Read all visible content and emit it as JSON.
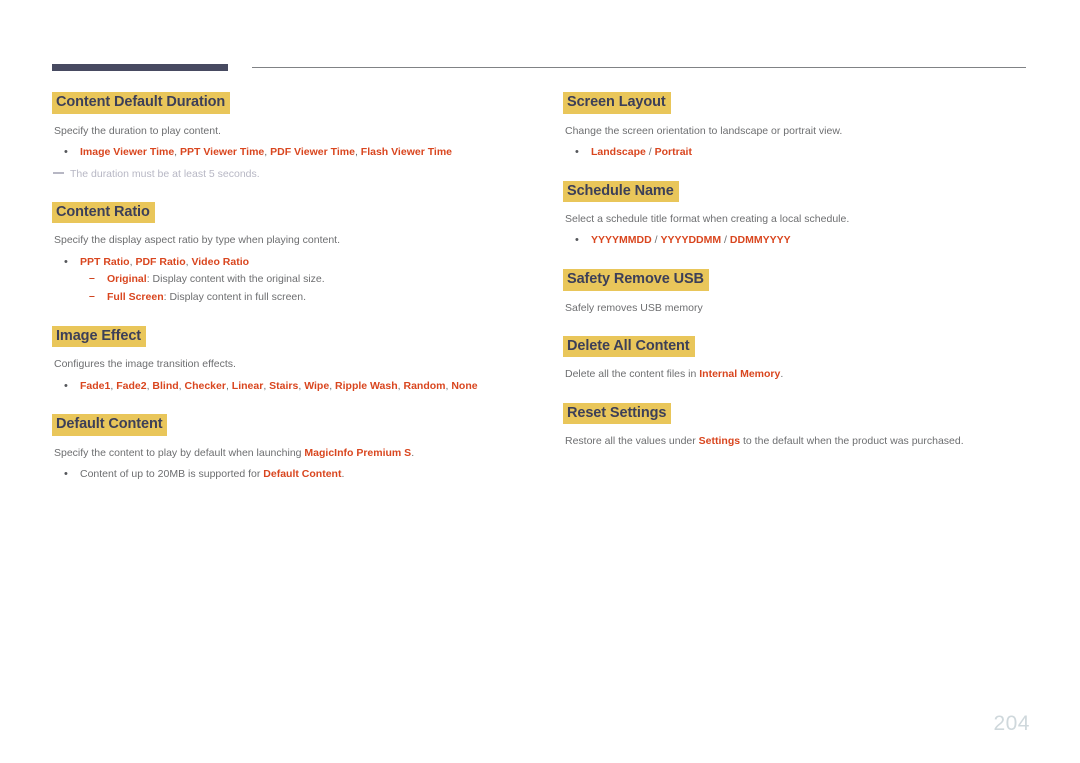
{
  "document": {
    "page_number": "204",
    "colors": {
      "heading_highlight": "#e9c65a",
      "heading_text": "#3c3f58",
      "body_text": "#6d6e70",
      "accent": "#d9461f",
      "rule_thick": "#474a61",
      "rule_thin": "#808285",
      "note_text": "#b7b7c4",
      "page_number": "#cfd8dc"
    }
  },
  "left_column": {
    "sections": [
      {
        "heading": "Content Default Duration",
        "description": "Specify the duration to play content.",
        "bullets": [
          {
            "parts": [
              {
                "text": "Image Viewer Time",
                "style": "hl"
              },
              {
                "text": ", ",
                "style": "plain"
              },
              {
                "text": "PPT Viewer Time",
                "style": "hl"
              },
              {
                "text": ", ",
                "style": "plain"
              },
              {
                "text": "PDF Viewer Time",
                "style": "hl"
              },
              {
                "text": ", ",
                "style": "plain"
              },
              {
                "text": "Flash Viewer Time",
                "style": "hl"
              }
            ]
          }
        ],
        "note": "The duration must be at least 5 seconds."
      },
      {
        "heading": "Content Ratio",
        "description": "Specify the display aspect ratio by type when playing content.",
        "bullets": [
          {
            "parts": [
              {
                "text": "PPT Ratio",
                "style": "hl"
              },
              {
                "text": ", ",
                "style": "plain"
              },
              {
                "text": "PDF Ratio",
                "style": "hl"
              },
              {
                "text": ", ",
                "style": "plain"
              },
              {
                "text": "Video Ratio",
                "style": "hl"
              }
            ],
            "subbullets": [
              {
                "parts": [
                  {
                    "text": "Original",
                    "style": "hl"
                  },
                  {
                    "text": ": Display content with the original size.",
                    "style": "plain"
                  }
                ]
              },
              {
                "parts": [
                  {
                    "text": "Full Screen",
                    "style": "hl"
                  },
                  {
                    "text": ": Display content in full screen.",
                    "style": "plain"
                  }
                ]
              }
            ]
          }
        ]
      },
      {
        "heading": "Image Effect",
        "description": "Configures the image transition effects.",
        "bullets": [
          {
            "parts": [
              {
                "text": "Fade1",
                "style": "hl"
              },
              {
                "text": ", ",
                "style": "plain"
              },
              {
                "text": "Fade2",
                "style": "hl"
              },
              {
                "text": ", ",
                "style": "plain"
              },
              {
                "text": "Blind",
                "style": "hl"
              },
              {
                "text": ", ",
                "style": "plain"
              },
              {
                "text": "Checker",
                "style": "hl"
              },
              {
                "text": ", ",
                "style": "plain"
              },
              {
                "text": "Linear",
                "style": "hl"
              },
              {
                "text": ", ",
                "style": "plain"
              },
              {
                "text": "Stairs",
                "style": "hl"
              },
              {
                "text": ", ",
                "style": "plain"
              },
              {
                "text": "Wipe",
                "style": "hl"
              },
              {
                "text": ", ",
                "style": "plain"
              },
              {
                "text": "Ripple Wash",
                "style": "hl"
              },
              {
                "text": ", ",
                "style": "plain"
              },
              {
                "text": "Random",
                "style": "hl"
              },
              {
                "text": ", ",
                "style": "plain"
              },
              {
                "text": "None",
                "style": "hl"
              }
            ]
          }
        ]
      },
      {
        "heading": "Default Content",
        "description_parts": [
          {
            "text": "Specify the content to play by default when launching ",
            "style": "plain"
          },
          {
            "text": "MagicInfo Premium S",
            "style": "hl"
          },
          {
            "text": ".",
            "style": "plain"
          }
        ],
        "bullets": [
          {
            "parts": [
              {
                "text": "Content of up to 20MB is supported for ",
                "style": "plain"
              },
              {
                "text": "Default Content",
                "style": "hl"
              },
              {
                "text": ".",
                "style": "plain"
              }
            ]
          }
        ]
      }
    ]
  },
  "right_column": {
    "sections": [
      {
        "heading": "Screen Layout",
        "description": "Change the screen orientation to landscape or portrait view.",
        "bullets": [
          {
            "parts": [
              {
                "text": "Landscape",
                "style": "hl"
              },
              {
                "text": " / ",
                "style": "plain"
              },
              {
                "text": "Portrait",
                "style": "hl"
              }
            ]
          }
        ]
      },
      {
        "heading": "Schedule Name",
        "description": "Select a schedule title format when creating a local schedule.",
        "bullets": [
          {
            "parts": [
              {
                "text": "YYYYMMDD",
                "style": "hl"
              },
              {
                "text": " / ",
                "style": "plain"
              },
              {
                "text": "YYYYDDMM",
                "style": "hl"
              },
              {
                "text": " / ",
                "style": "plain"
              },
              {
                "text": "DDMMYYYY",
                "style": "hl"
              }
            ]
          }
        ]
      },
      {
        "heading": "Safety Remove USB",
        "description": "Safely removes USB memory"
      },
      {
        "heading": "Delete All Content",
        "description_parts": [
          {
            "text": "Delete all the content files in ",
            "style": "plain"
          },
          {
            "text": "Internal Memory",
            "style": "hl"
          },
          {
            "text": ".",
            "style": "plain"
          }
        ]
      },
      {
        "heading": "Reset Settings",
        "description_parts": [
          {
            "text": "Restore all the values under ",
            "style": "plain"
          },
          {
            "text": "Settings",
            "style": "hl"
          },
          {
            "text": " to the default when the product was purchased.",
            "style": "plain"
          }
        ]
      }
    ]
  }
}
